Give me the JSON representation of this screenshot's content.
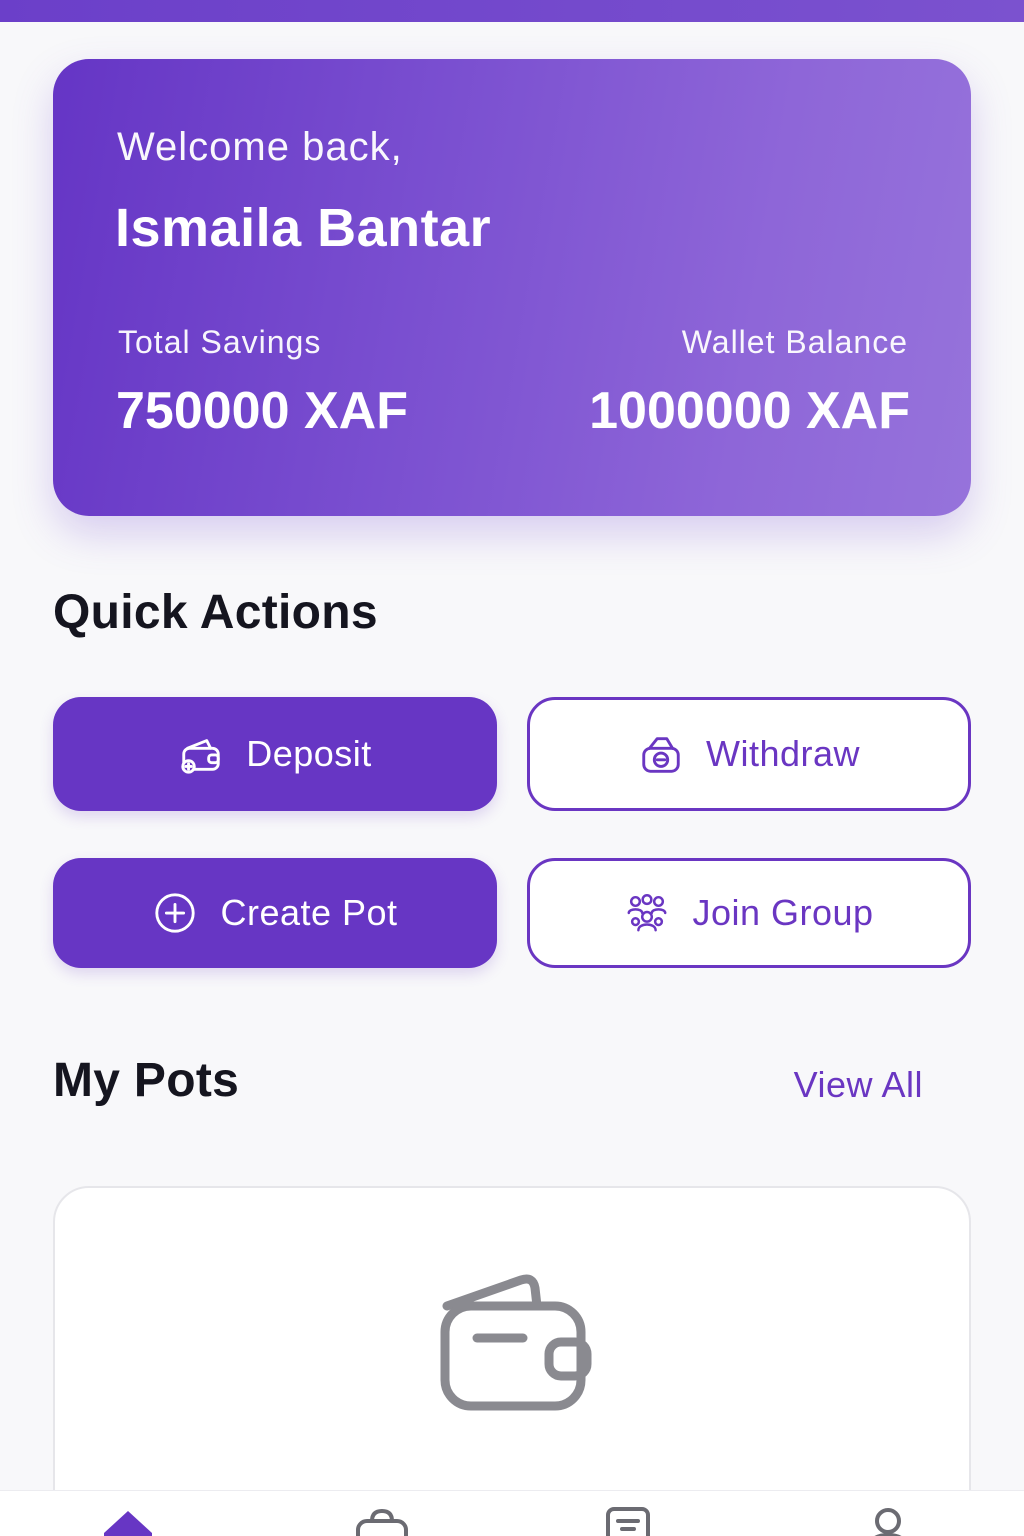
{
  "hero": {
    "greeting": "Welcome back,",
    "user_name": "Ismaila Bantar",
    "total_savings_label": "Total Savings",
    "total_savings_value": "750000 XAF",
    "wallet_balance_label": "Wallet Balance",
    "wallet_balance_value": "1000000 XAF"
  },
  "quick_actions": {
    "title": "Quick Actions",
    "deposit": {
      "label": "Deposit",
      "icon": "wallet-plus-icon"
    },
    "withdraw": {
      "label": "Withdraw",
      "icon": "wallet-minus-icon"
    },
    "create_pot": {
      "label": "Create Pot",
      "icon": "plus-circle-icon"
    },
    "join_group": {
      "label": "Join Group",
      "icon": "group-icon"
    }
  },
  "pots": {
    "title": "My Pots",
    "view_all": "View All",
    "empty_icon": "wallet-icon"
  },
  "bottom_nav": {
    "items": [
      {
        "icon": "home-icon",
        "active": true
      },
      {
        "icon": "bag-icon",
        "active": false
      },
      {
        "icon": "document-icon",
        "active": false
      },
      {
        "icon": "profile-icon",
        "active": false
      }
    ]
  },
  "colors": {
    "accent": "#6736c4",
    "hero_gradient_start": "#6535c5",
    "hero_gradient_end": "#9673db",
    "text_dark": "#15151f",
    "icon_muted": "#8a8a90"
  }
}
